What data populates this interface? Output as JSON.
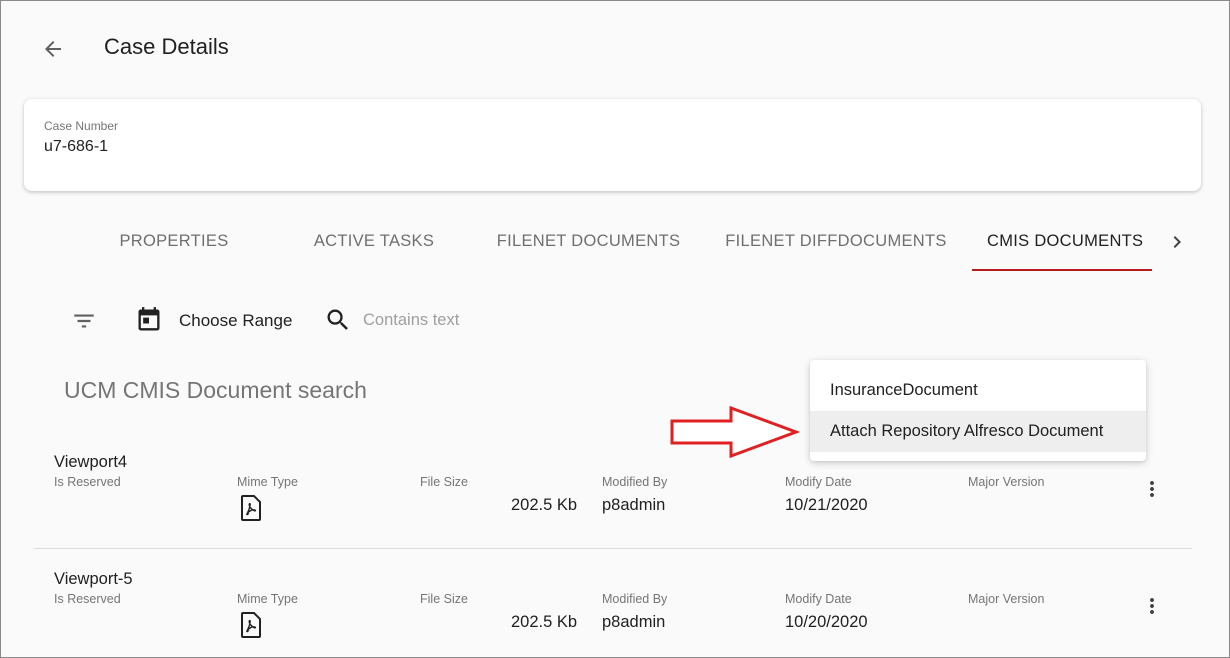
{
  "header": {
    "title": "Case Details",
    "back_icon": "arrow-back-icon"
  },
  "case": {
    "number_label": "Case Number",
    "number_value": "u7-686-1"
  },
  "tabs": [
    {
      "label": "PROPERTIES",
      "active": false
    },
    {
      "label": "ACTIVE TASKS",
      "active": false
    },
    {
      "label": "FILENET DOCUMENTS",
      "active": false
    },
    {
      "label": "FILENET DIFFDOCUMENTS",
      "active": false
    },
    {
      "label": "CMIS DOCUMENTS",
      "active": true
    }
  ],
  "toolbar": {
    "range_label": "Choose Range",
    "search_placeholder": "Contains text",
    "search_value": ""
  },
  "section": {
    "title": "UCM CMIS Document search"
  },
  "dropdown": {
    "items": [
      {
        "label": "InsuranceDocument",
        "highlighted": false
      },
      {
        "label": "Attach Repository Alfresco Document",
        "highlighted": true
      }
    ]
  },
  "columns": {
    "reserved": "Is Reserved",
    "mime": "Mime Type",
    "size": "File Size",
    "modified_by": "Modified By",
    "modify_date": "Modify Date",
    "major_version": "Major Version"
  },
  "documents": [
    {
      "name": "Viewport4",
      "mime_icon": "pdf-icon",
      "file_size": "202.5 Kb",
      "modified_by": "p8admin",
      "modify_date": "10/21/2020",
      "major_version": ""
    },
    {
      "name": "Viewport-5",
      "mime_icon": "pdf-icon",
      "file_size": "202.5 Kb",
      "modified_by": "p8admin",
      "modify_date": "10/20/2020",
      "major_version": ""
    }
  ],
  "colors": {
    "accent": "#b71c1c",
    "annotation_arrow": "#e02020"
  }
}
